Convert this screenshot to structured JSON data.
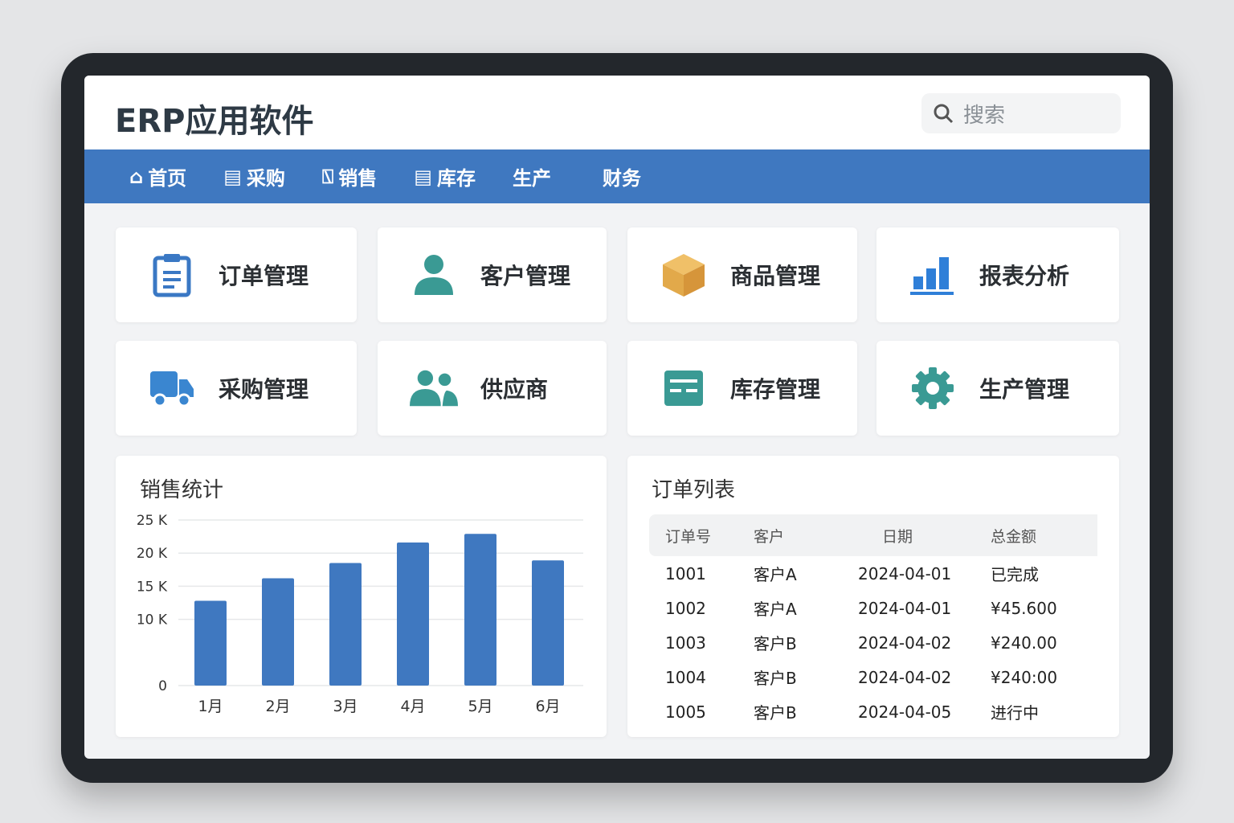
{
  "header": {
    "title": "ERP应用软件",
    "search_placeholder": "搜索"
  },
  "nav": [
    {
      "label": "首页",
      "icon": "home-icon"
    },
    {
      "label": "采购",
      "icon": "document-icon"
    },
    {
      "label": "销售",
      "icon": "tag-icon"
    },
    {
      "label": "库存",
      "icon": "box-icon"
    },
    {
      "label": "生产",
      "icon": ""
    },
    {
      "label": "财务",
      "icon": ""
    }
  ],
  "modules": [
    {
      "label": "订单管理",
      "icon": "clipboard-icon",
      "color": "#3a78c4"
    },
    {
      "label": "客户管理",
      "icon": "user-icon",
      "color": "#3a9a94"
    },
    {
      "label": "商品管理",
      "icon": "package-icon",
      "color": "#e2a94a"
    },
    {
      "label": "报表分析",
      "icon": "bar-chart-icon",
      "color": "#2f7fd8"
    },
    {
      "label": "采购管理",
      "icon": "truck-icon",
      "color": "#3a86d0"
    },
    {
      "label": "供应商",
      "icon": "users-icon",
      "color": "#3a9a94"
    },
    {
      "label": "库存管理",
      "icon": "inventory-icon",
      "color": "#3a9a94"
    },
    {
      "label": "生产管理",
      "icon": "gear-icon",
      "color": "#3a9a94"
    }
  ],
  "chart_data": {
    "type": "bar",
    "title": "销售统计",
    "categories": [
      "1月",
      "2月",
      "3月",
      "4月",
      "5月",
      "6月"
    ],
    "values": [
      12800,
      16200,
      18500,
      21600,
      22900,
      18900
    ],
    "ylim": [
      0,
      25000
    ],
    "yticks": [
      "25 K",
      "20 K",
      "15 K",
      "10 K",
      "0"
    ],
    "ytick_values": [
      25000,
      20000,
      15000,
      10000,
      0
    ],
    "color": "#3f78c0",
    "grid": true
  },
  "orders": {
    "title": "订单列表",
    "columns": [
      "订单号",
      "客户",
      "日期",
      "总金额"
    ],
    "rows": [
      [
        "1001",
        "客户A",
        "2024-04-01",
        "已完成"
      ],
      [
        "1002",
        "客户A",
        "2024-04-01",
        "¥45.600"
      ],
      [
        "1003",
        "客户B",
        "2024-04-02",
        "¥240.00"
      ],
      [
        "1004",
        "客户B",
        "2024-04-02",
        "¥240:00"
      ],
      [
        "1005",
        "客户B",
        "2024-04-05",
        "进行中"
      ]
    ]
  }
}
